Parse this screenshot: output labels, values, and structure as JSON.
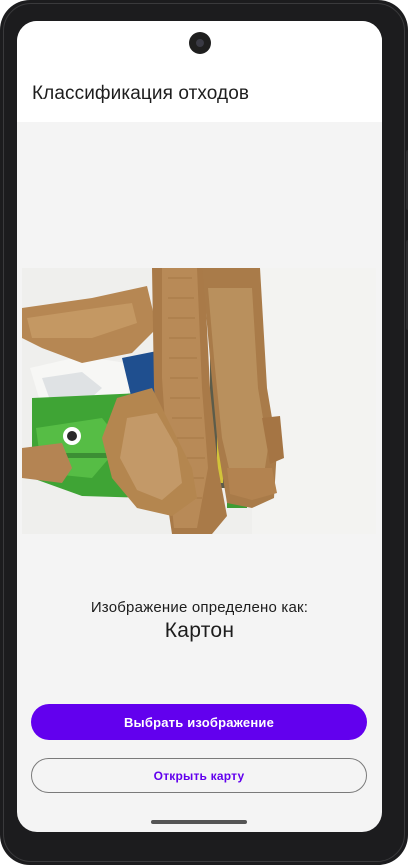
{
  "app_bar": {
    "title": "Классификация отходов"
  },
  "image": {
    "icon": "cardboard-waste-photo"
  },
  "result": {
    "label": "Изображение определено как:",
    "value": "Картон"
  },
  "buttons": {
    "select_image": "Выбрать изображение",
    "open_map": "Открыть карту"
  },
  "colors": {
    "accent": "#6200ee",
    "screen_background": "#f4f4f4",
    "app_bar_background": "#ffffff",
    "device_frame": "#1c1c1e"
  }
}
